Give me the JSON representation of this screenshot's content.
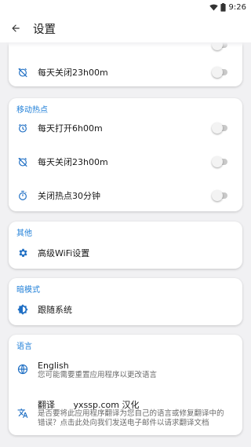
{
  "status_bar": {
    "time": "9:26"
  },
  "app_bar": {
    "title": "设置"
  },
  "sections": {
    "schedule_top": {
      "close_daily_label": "每天关闭23h00m"
    },
    "hotspot": {
      "header": "移动热点",
      "open_daily_label": "每天打开6h00m",
      "close_daily_label": "每天关闭23h00m",
      "close_hotspot_label": "关闭热点30分钟"
    },
    "other": {
      "header": "其他",
      "advanced_wifi_label": "高级WiFi设置"
    },
    "dark_mode": {
      "header": "暗模式",
      "follow_system_label": "跟随系统"
    },
    "language": {
      "header": "语言",
      "english_label": "English",
      "english_sub": "您可能需要重置应用程序以更改语言",
      "translate_label": "翻译",
      "translate_credit": "yxssp.com 汉化",
      "translate_sub": "是否要将此应用程序翻译为您自己的语言或修复翻译中的错误？点击此处向我们发送电子邮件以请求翻译文档"
    }
  },
  "toggles": {
    "top_close_daily": false,
    "hotspot_open_daily": false,
    "hotspot_close_daily": false,
    "hotspot_close_30": false
  },
  "colors": {
    "accent": "#1f7fd8",
    "icon": "#1f6fc4",
    "toggle_track": "#c9c9c9",
    "background": "#f1f1f3"
  },
  "icons": {
    "back": "arrow-left-icon",
    "alarm_off": "alarm-off-icon",
    "alarm": "alarm-icon",
    "timer": "timer-icon",
    "settings": "gear-icon",
    "brightness": "brightness-auto-icon",
    "globe": "globe-icon",
    "translate": "translate-icon",
    "wifi": "wifi-icon",
    "battery": "battery-icon"
  }
}
